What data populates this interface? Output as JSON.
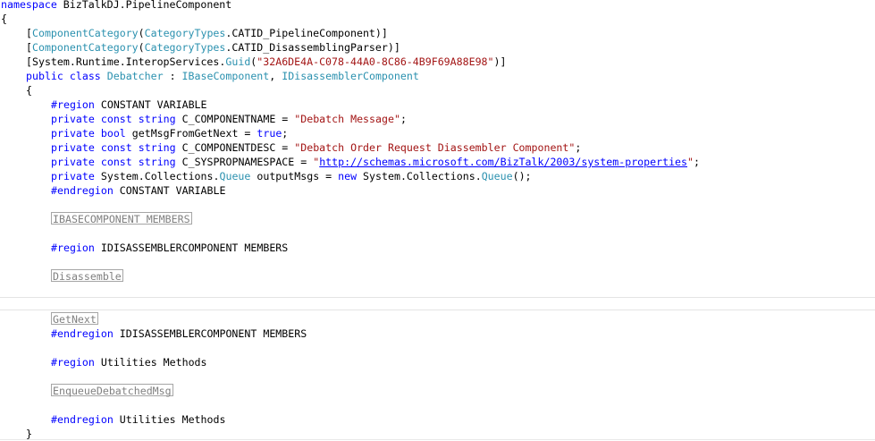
{
  "code": {
    "l1": {
      "kw": "namespace",
      "rest": " BizTalkDJ.PipelineComponent"
    },
    "l2": {
      "text": "{"
    },
    "l3": {
      "open": "[",
      "type1": "ComponentCategory",
      "p1": "(",
      "type2": "CategoryTypes",
      "rest": ".CATID_PipelineComponent)]"
    },
    "l4": {
      "open": "[",
      "type1": "ComponentCategory",
      "p1": "(",
      "type2": "CategoryTypes",
      "rest": ".CATID_DisassemblingParser)]"
    },
    "l5": {
      "pre": "[System.Runtime.InteropServices.",
      "type1": "Guid",
      "p1": "(",
      "str": "\"32A6DE4A-C078-44A0-8C86-4B9F69A88E98\"",
      "rest": ")]"
    },
    "l6": {
      "kw1": "public",
      "sp1": " ",
      "kw2": "class",
      "sp2": " ",
      "type1": "Debatcher",
      "p1": " : ",
      "type2": "IBaseComponent",
      "p2": ", ",
      "type3": "IDisassemblerComponent"
    },
    "l7": {
      "text": "{"
    },
    "l8": {
      "kw": "#region",
      "rest": " CONSTANT VARIABLE"
    },
    "l9": {
      "kw1": "private",
      "sp1": " ",
      "kw2": "const",
      "sp2": " ",
      "kw3": "string",
      "mid": " C_COMPONENTNAME = ",
      "str": "\"Debatch Message\"",
      "end": ";"
    },
    "l10": {
      "kw1": "private",
      "sp1": " ",
      "kw2": "bool",
      "mid": " getMsgFromGetNext = ",
      "kw3": "true",
      "end": ";"
    },
    "l11": {
      "kw1": "private",
      "sp1": " ",
      "kw2": "const",
      "sp2": " ",
      "kw3": "string",
      "mid": " C_COMPONENTDESC = ",
      "str": "\"Debatch Order Request Diassembler Component\"",
      "end": ";"
    },
    "l12": {
      "kw1": "private",
      "sp1": " ",
      "kw2": "const",
      "sp2": " ",
      "kw3": "string",
      "mid": " C_SYSPROPNAMESPACE = ",
      "q1": "\"",
      "link": "http://schemas.microsoft.com/BizTalk/2003/system-properties",
      "q2": "\"",
      "end": ";"
    },
    "l13": {
      "kw1": "private",
      "mid1": " System.Collections.",
      "type1": "Queue",
      "mid2": " outputMsgs = ",
      "kw2": "new",
      "mid3": " System.Collections.",
      "type2": "Queue",
      "end": "();"
    },
    "l14": {
      "kw": "#endregion",
      "rest": " CONSTANT VARIABLE"
    },
    "l15": {
      "collapsed": "IBASECOMPONENT MEMBERS"
    },
    "l16": {
      "kw": "#region",
      "rest": " IDISASSEMBLERCOMPONENT MEMBERS"
    },
    "l17": {
      "collapsed": "Disassemble"
    },
    "l18": {
      "collapsed": "GetNext"
    },
    "l19": {
      "kw": "#endregion",
      "rest": " IDISASSEMBLERCOMPONENT MEMBERS"
    },
    "l20": {
      "kw": "#region",
      "rest": " Utilities Methods"
    },
    "l21": {
      "collapsed": "EnqueueDebatchedMsg"
    },
    "l22": {
      "kw": "#endregion",
      "rest": " Utilities Methods"
    },
    "l23": {
      "text": "}"
    }
  },
  "colors": {
    "keyword": "#0000ff",
    "type": "#2b91af",
    "string": "#a31515",
    "collapsed_text": "#808080",
    "collapsed_border": "#a5a5a5"
  }
}
